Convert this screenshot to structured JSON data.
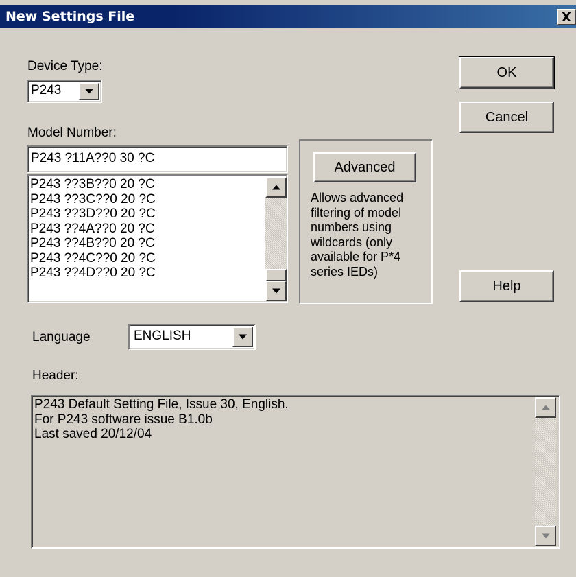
{
  "window": {
    "title": "New Settings File",
    "close_glyph": "X"
  },
  "device_type": {
    "label": "Device Type:",
    "value": "P243"
  },
  "model_number": {
    "label": "Model Number:",
    "input_value": "P243 ?11A??0 30 ?C",
    "items": [
      "P243 ??3B??0 20 ?C",
      "P243 ??3C??0 20 ?C",
      "P243 ??3D??0 20 ?C",
      "P243 ??4A??0 20 ?C",
      "P243 ??4B??0 20 ?C",
      "P243 ??4C??0 20 ?C",
      "P243 ??4D??0 20 ?C"
    ]
  },
  "advanced": {
    "button_label": "Advanced",
    "description_lines": [
      "Allows advanced",
      "filtering of model",
      "numbers using",
      "wildcards (only",
      "available for P*4",
      "series IEDs)"
    ]
  },
  "buttons": {
    "ok": "OK",
    "cancel": "Cancel",
    "help": "Help"
  },
  "language": {
    "label": "Language",
    "value": "ENGLISH"
  },
  "header": {
    "label": "Header:",
    "lines": [
      "P243 Default Setting File, Issue 30, English.",
      "For P243 software issue B1.0b",
      "Last saved 20/12/04"
    ]
  },
  "icons": {
    "scroll_up": "scroll-up-arrow-icon",
    "scroll_down": "scroll-down-arrow-icon",
    "dropdown": "chevron-down-icon"
  }
}
